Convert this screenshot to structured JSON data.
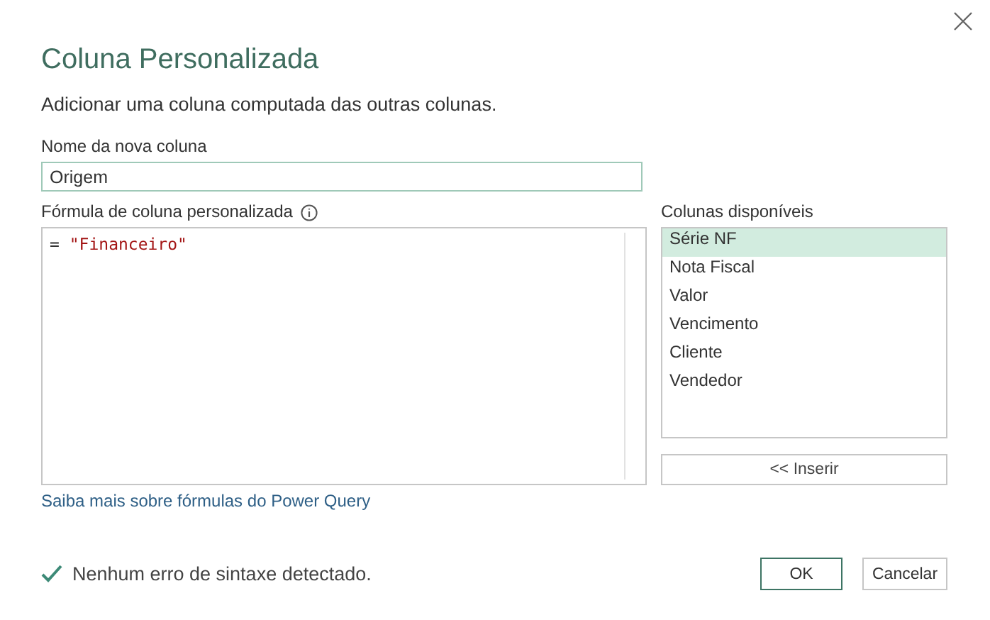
{
  "dialog": {
    "title": "Coluna Personalizada",
    "description": "Adicionar uma coluna computada das outras colunas."
  },
  "name_field": {
    "label": "Nome da nova coluna",
    "value": "Origem"
  },
  "formula": {
    "label": "Fórmula de coluna personalizada",
    "tokens": [
      {
        "kind": "operator",
        "text": "="
      },
      {
        "kind": "string",
        "text": "\"Financeiro\""
      }
    ]
  },
  "available_columns": {
    "label": "Colunas disponíveis",
    "items": [
      {
        "label": "Série NF",
        "selected": true
      },
      {
        "label": "Nota Fiscal",
        "selected": false
      },
      {
        "label": "Valor",
        "selected": false
      },
      {
        "label": "Vencimento",
        "selected": false
      },
      {
        "label": "Cliente",
        "selected": false
      },
      {
        "label": "Vendedor",
        "selected": false
      }
    ],
    "insert_button": "<< Inserir"
  },
  "help_link": "Saiba mais sobre fórmulas do Power Query",
  "status": {
    "kind": "ok",
    "text": "Nenhum erro de sintaxe detectado."
  },
  "buttons": [
    {
      "label": "OK",
      "kind": "primary"
    },
    {
      "label": "Cancelar",
      "kind": "secondary"
    }
  ]
}
